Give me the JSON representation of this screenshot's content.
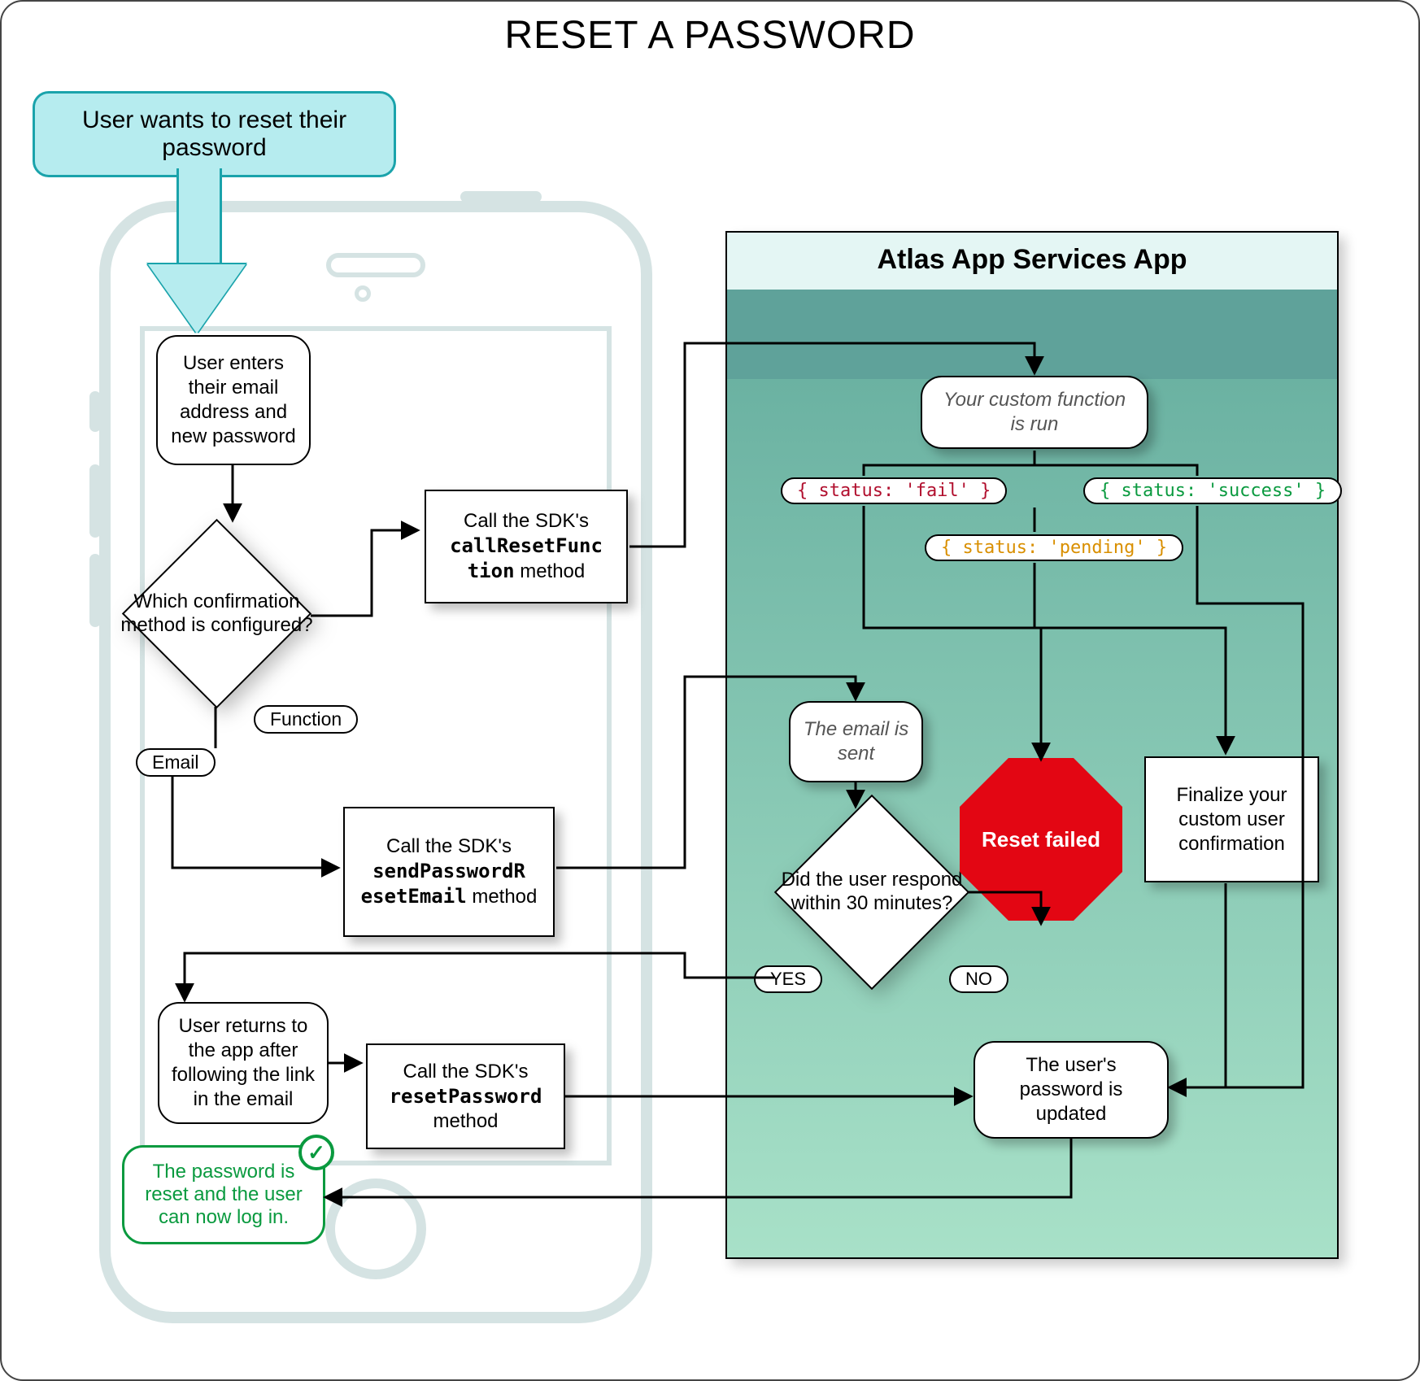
{
  "title": "RESET A PASSWORD",
  "callout": "User wants to reset their password",
  "phone": {
    "enter": "User enters their email address and new password",
    "decision_config": "Which confirmation method is configured?",
    "label_function": "Function",
    "label_email": "Email",
    "sdk_callReset_pre": "Call the SDK's ",
    "sdk_callReset_code": "callResetFunc\ntion",
    "sdk_callReset_post": " method",
    "sdk_sendEmail_pre": "Call the SDK's ",
    "sdk_sendEmail_code": "sendPasswordR\nesetEmail",
    "sdk_sendEmail_post": " method",
    "return_app": "User returns to the app after following the link in the email",
    "sdk_resetPwd_pre": "Call the SDK's ",
    "sdk_resetPwd_code": "resetPassword",
    "sdk_resetPwd_post": " method",
    "success": "The password is reset and the user can now log in."
  },
  "server": {
    "title": "Atlas App Services App",
    "custom_fn": "Your custom function is run",
    "status_fail": "{ status: 'fail' }",
    "status_success": "{ status: 'success' }",
    "status_pending": "{ status: 'pending' }",
    "email_sent": "The email is sent",
    "decision_30": "Did the user respond within 30 minutes?",
    "yes": "YES",
    "no": "NO",
    "reset_failed": "Reset failed",
    "finalize": "Finalize your custom user confirmation",
    "updated": "The user's password is updated"
  },
  "colors": {
    "fail": "#b10f2e",
    "success": "#0a9a3f",
    "pending": "#d98f00"
  }
}
